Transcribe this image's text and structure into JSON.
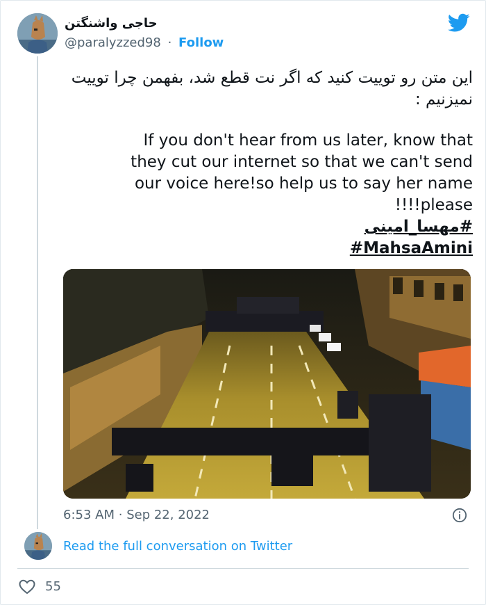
{
  "user": {
    "display_name": "حاجی واشنگتن",
    "handle": "@paralyzzed98",
    "separator": "·",
    "follow_label": "Follow"
  },
  "tweet": {
    "persian_text": "این متن رو توییت کنید که اگر نت قطع شد، بفهمن چرا توییت نمیزنیم :",
    "english_lines": [
      "If you don't hear from us later, know that",
      "they cut our internet so that we can't send",
      "our voice here!so help us to say her name",
      "please!!!!"
    ],
    "hashtags": [
      "#مهسا_امینی",
      "#MahsaAmini"
    ]
  },
  "meta": {
    "time": "6:53 AM",
    "separator": "·",
    "date": "Sep 22, 2022"
  },
  "footer": {
    "read_full_label": "Read the full conversation on Twitter",
    "like_count": "55"
  },
  "icons": {
    "brand": "twitter-bird-icon",
    "info": "info-icon",
    "like": "heart-icon"
  },
  "colors": {
    "twitter_blue": "#1d9bf0",
    "secondary_text": "#536471",
    "primary_text": "#0f1419"
  }
}
